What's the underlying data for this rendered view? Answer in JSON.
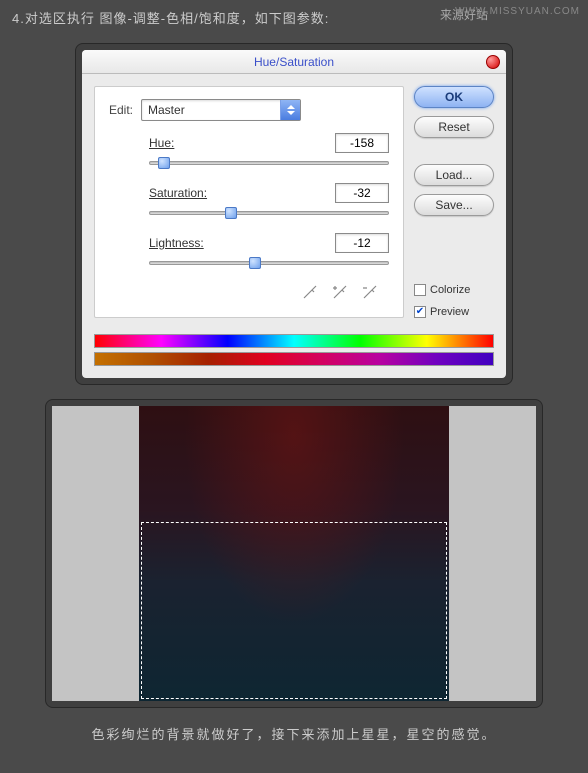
{
  "instruction": "4.对选区执行 图像-调整-色相/饱和度，如下图参数:",
  "watermark_cn": "来源好站",
  "watermark_url": "WWW.MISSYUAN.COM",
  "dialog": {
    "title": "Hue/Saturation",
    "edit_label": "Edit:",
    "edit_value": "Master",
    "hue": {
      "label": "Hue:",
      "value": "-158",
      "pos": 6
    },
    "saturation": {
      "label": "Saturation:",
      "value": "-32",
      "pos": 34
    },
    "lightness": {
      "label": "Lightness:",
      "value": "-12",
      "pos": 44
    },
    "buttons": {
      "ok": "OK",
      "reset": "Reset",
      "load": "Load...",
      "save": "Save..."
    },
    "colorize": "Colorize",
    "preview": "Preview"
  },
  "footer": "色彩绚烂的背景就做好了，接下来添加上星星，星空的感觉。"
}
